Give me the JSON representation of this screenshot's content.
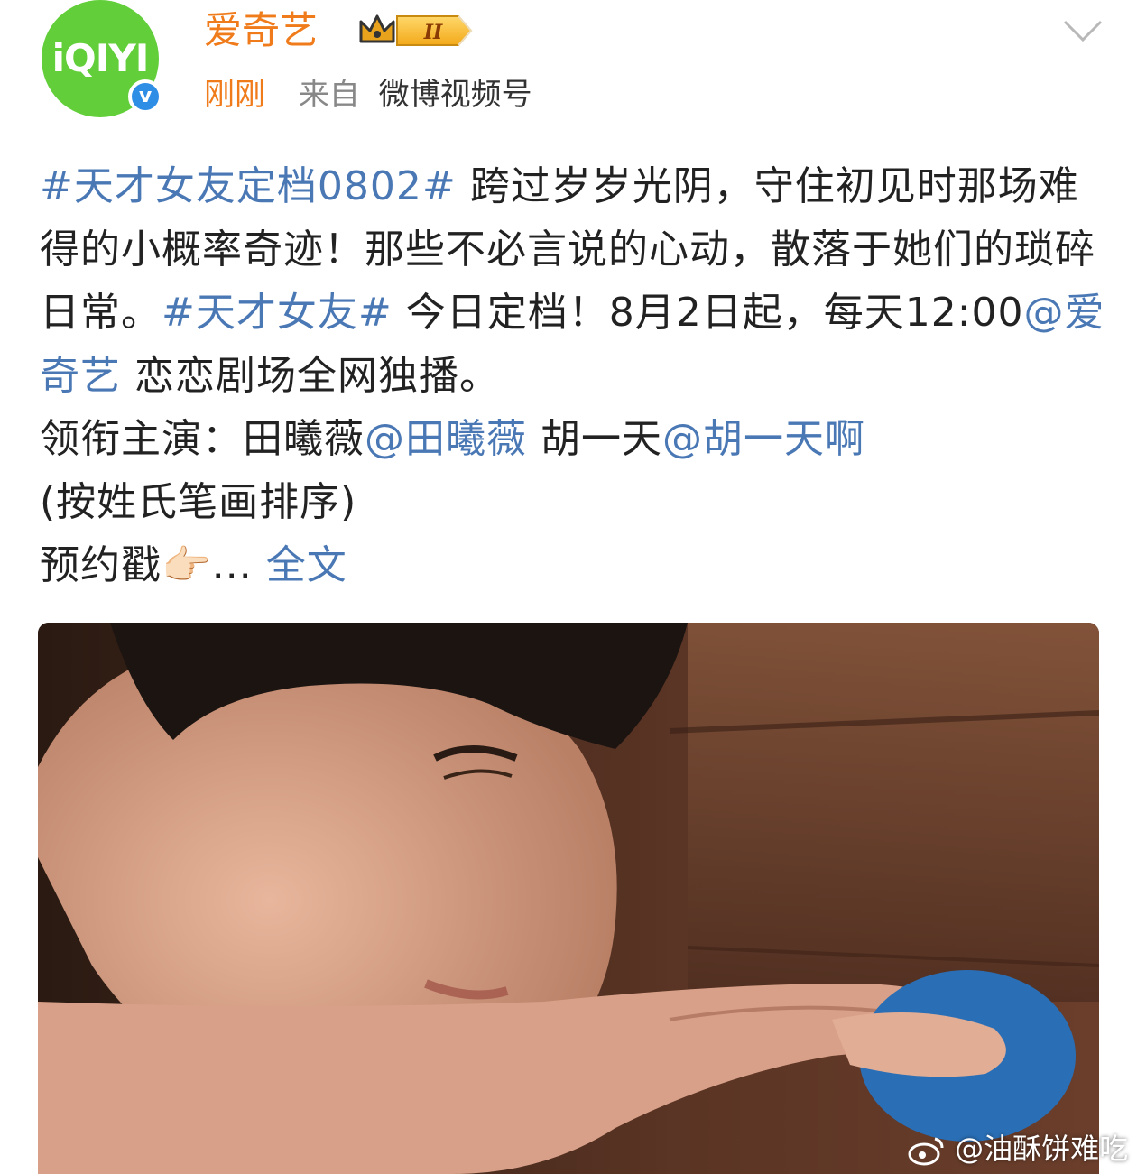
{
  "post": {
    "author": {
      "name": "爱奇艺",
      "avatar_logo": "iQIYI",
      "verified_mark": "v",
      "level_badge": "II"
    },
    "time": "刚刚",
    "source_label": "来自",
    "source": "微博视频号",
    "text": {
      "hashtag1": "#天才女友定档0802#",
      "seg1": " 跨过岁岁光阴，守住初见时那场难得的小概率奇迹！那些不必言说的心动，散落于她们的琐碎日常。",
      "hashtag2": "#天才女友#",
      "seg2": " 今日定档！8月2日起，每天12:00",
      "mention1": "@爱奇艺",
      "seg3": " 恋恋剧场全网独播。",
      "seg4": "领衔主演：田曦薇",
      "mention2": "@田曦薇",
      "seg5": " 胡一天",
      "mention3": "@胡一天啊",
      "seg6": "(按姓氏笔画排序)",
      "seg7": "预约戳👉🏻...",
      "expand": "全文"
    },
    "watermark": "@油酥饼难吃"
  },
  "colors": {
    "username": "#f07b1a",
    "link": "#4a78b5",
    "avatar_bg": "#62cf3a",
    "verified": "#2e8ee6"
  },
  "icons": {
    "dropdown": "chevron-down-icon",
    "badge": "crown-icon",
    "watermark": "weibo-icon"
  }
}
